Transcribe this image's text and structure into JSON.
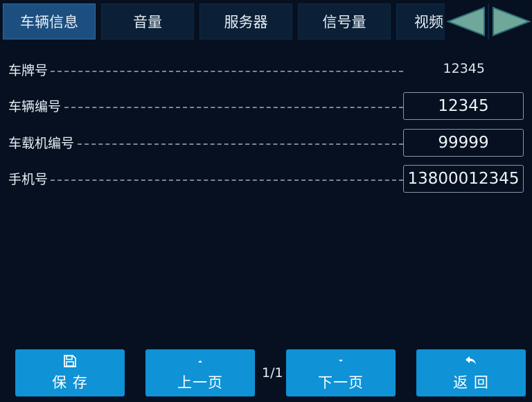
{
  "tabs": [
    {
      "label": "车辆信息",
      "active": true
    },
    {
      "label": "音量",
      "active": false
    },
    {
      "label": "服务器",
      "active": false
    },
    {
      "label": "信号量",
      "active": false
    },
    {
      "label": "视频",
      "active": false
    }
  ],
  "nav": {
    "prev_icon": "triangle-left-icon",
    "next_icon": "triangle-right-icon",
    "arrow_color": "#6fa89a"
  },
  "fields": [
    {
      "label": "车牌号",
      "value": "12345",
      "editable": false
    },
    {
      "label": "车辆编号",
      "value": "12345",
      "editable": true
    },
    {
      "label": "车载机编号",
      "value": "99999",
      "editable": true
    },
    {
      "label": "手机号",
      "value": "13800012345",
      "editable": true
    }
  ],
  "footer": {
    "save_label": "保 存",
    "save_icon": "floppy-disk-icon",
    "prev_label": "上一页",
    "prev_icon": "caret-up-icon",
    "page_indicator": "1/1",
    "next_label": "下一页",
    "next_icon": "caret-down-icon",
    "back_label": "返 回",
    "back_icon": "undo-arrow-icon"
  },
  "colors": {
    "background": "#061020",
    "active_tab": "#1c4f80",
    "button": "#0f92d6"
  }
}
